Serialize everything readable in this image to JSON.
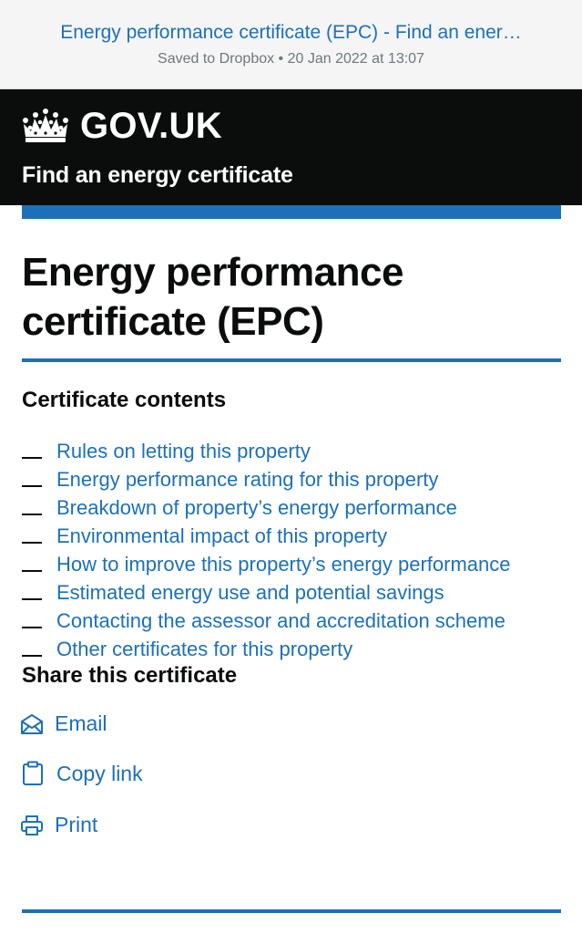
{
  "browser": {
    "page_title": "Energy performance certificate (EPC) - Find an ener…",
    "saved_text": "Saved to Dropbox • 20 Jan 2022 at 13:07"
  },
  "header": {
    "logo_text": "GOV.UK",
    "logo_icon": "crown-icon",
    "service_name": "Find an energy certificate"
  },
  "main": {
    "title": "Energy performance certificate (EPC)",
    "contents_heading": "Certificate contents",
    "contents": [
      "Rules on letting this property",
      "Energy performance rating for this property",
      "Breakdown of property’s energy performance",
      "Environmental impact of this property",
      "How to improve this property’s energy performance",
      "Estimated energy use and potential savings",
      "Contacting the assessor and accreditation scheme",
      "Other certificates for this property"
    ],
    "share_heading": "Share this certificate",
    "share": {
      "email": "Email",
      "copy_link": "Copy link",
      "print": "Print"
    }
  },
  "colors": {
    "link": "#1d70b8",
    "header_bg": "#0b0c0c",
    "accent_bar": "#1d70b8"
  }
}
